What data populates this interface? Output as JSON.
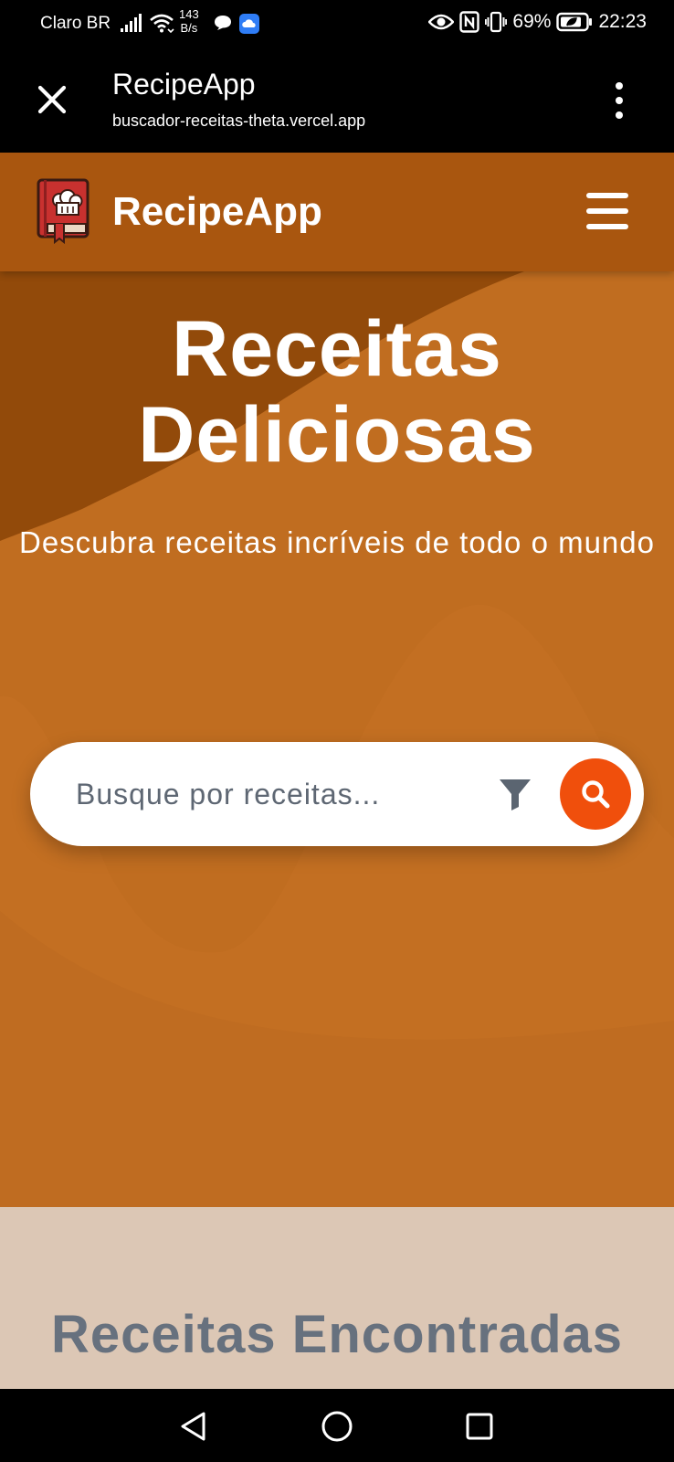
{
  "status_bar": {
    "carrier": "Claro BR",
    "speed_value": "143",
    "speed_unit": "B/s",
    "battery": "69%",
    "time": "22:23",
    "icons": [
      "signal-icon",
      "wifi-icon",
      "message-icon",
      "cloud-icon",
      "eye-icon",
      "nfc-icon",
      "vibrate-icon",
      "battery-icon"
    ]
  },
  "browser": {
    "title": "RecipeApp",
    "url": "buscador-receitas-theta.vercel.app",
    "icons": [
      "close-icon",
      "more-vert-icon"
    ]
  },
  "header": {
    "brand": "RecipeApp",
    "icons": [
      "cookbook-logo-icon",
      "hamburger-menu-icon"
    ]
  },
  "hero": {
    "title_line1": "Receitas",
    "title_line2": "Deliciosas",
    "subtitle": "Descubra receitas incríveis de todo o mundo"
  },
  "search": {
    "placeholder": "Busque por receitas...",
    "value": "",
    "icons": [
      "filter-icon",
      "search-icon"
    ]
  },
  "results": {
    "title": "Receitas Encontradas"
  },
  "nav": {
    "icons": [
      "back-icon",
      "home-icon",
      "recents-icon"
    ]
  },
  "colors": {
    "header_bg": "#a9560f",
    "hero_bg": "#c06d20",
    "search_button": "#f04f0c",
    "results_bg": "#dcc7b5",
    "results_title": "#67717e"
  }
}
